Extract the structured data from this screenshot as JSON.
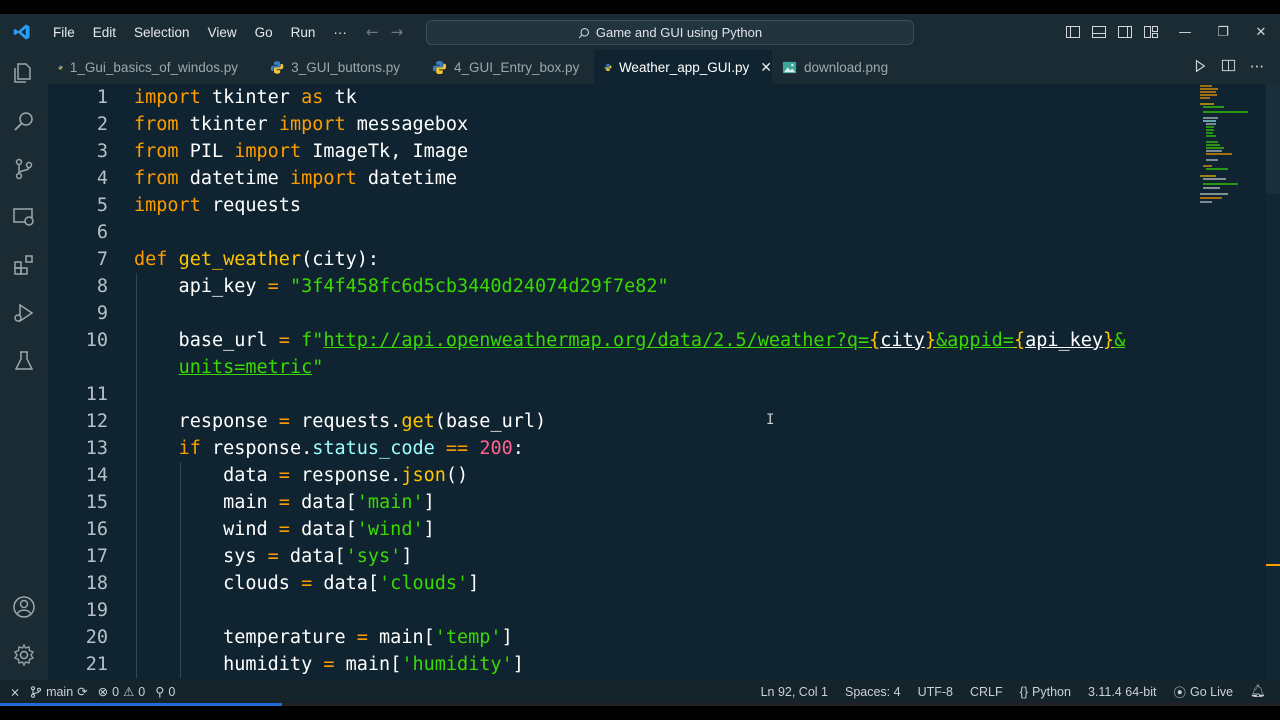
{
  "window": {
    "command_center_text": "Game and GUI using Python",
    "menu": [
      "File",
      "Edit",
      "Selection",
      "View",
      "Go",
      "Run",
      "···"
    ]
  },
  "tabs": [
    {
      "label": "1_Gui_basics_of_windos.py",
      "active": false
    },
    {
      "label": "3_GUI_buttons.py",
      "active": false
    },
    {
      "label": "4_GUI_Entry_box.py",
      "active": false
    },
    {
      "label": "Weather_app_GUI.py",
      "active": true
    },
    {
      "label": "download.png",
      "active": false
    }
  ],
  "code": {
    "line_numbers": [
      "1",
      "2",
      "3",
      "4",
      "5",
      "6",
      "7",
      "8",
      "9",
      "10",
      "",
      "11",
      "12",
      "13",
      "14",
      "15",
      "16",
      "17",
      "18",
      "19",
      "20",
      "21"
    ]
  },
  "statusbar": {
    "branch": "main",
    "errors": "0",
    "warnings": "0",
    "ports": "0",
    "cursor_position": "Ln 92, Col 1",
    "indentation": "Spaces: 4",
    "encoding": "UTF-8",
    "line_endings": "CRLF",
    "language": "Python",
    "interpreter": "3.11.4 64-bit",
    "live_server": "Go Live"
  },
  "colors": {
    "editor_background": "#0f2430",
    "keyword": "#ff9d00",
    "function": "#ffc600",
    "string": "#3ad900",
    "number": "#ff628c",
    "attribute": "#9effff"
  },
  "icons": [
    "vscode-logo-icon",
    "explorer-icon",
    "search-icon",
    "source-control-icon",
    "remote-explorer-icon",
    "extensions-icon",
    "run-debug-icon",
    "testing-icon",
    "account-icon",
    "settings-gear-icon",
    "python-file-icon",
    "image-file-icon",
    "run-icon",
    "split-editor-icon",
    "more-actions-icon"
  ]
}
